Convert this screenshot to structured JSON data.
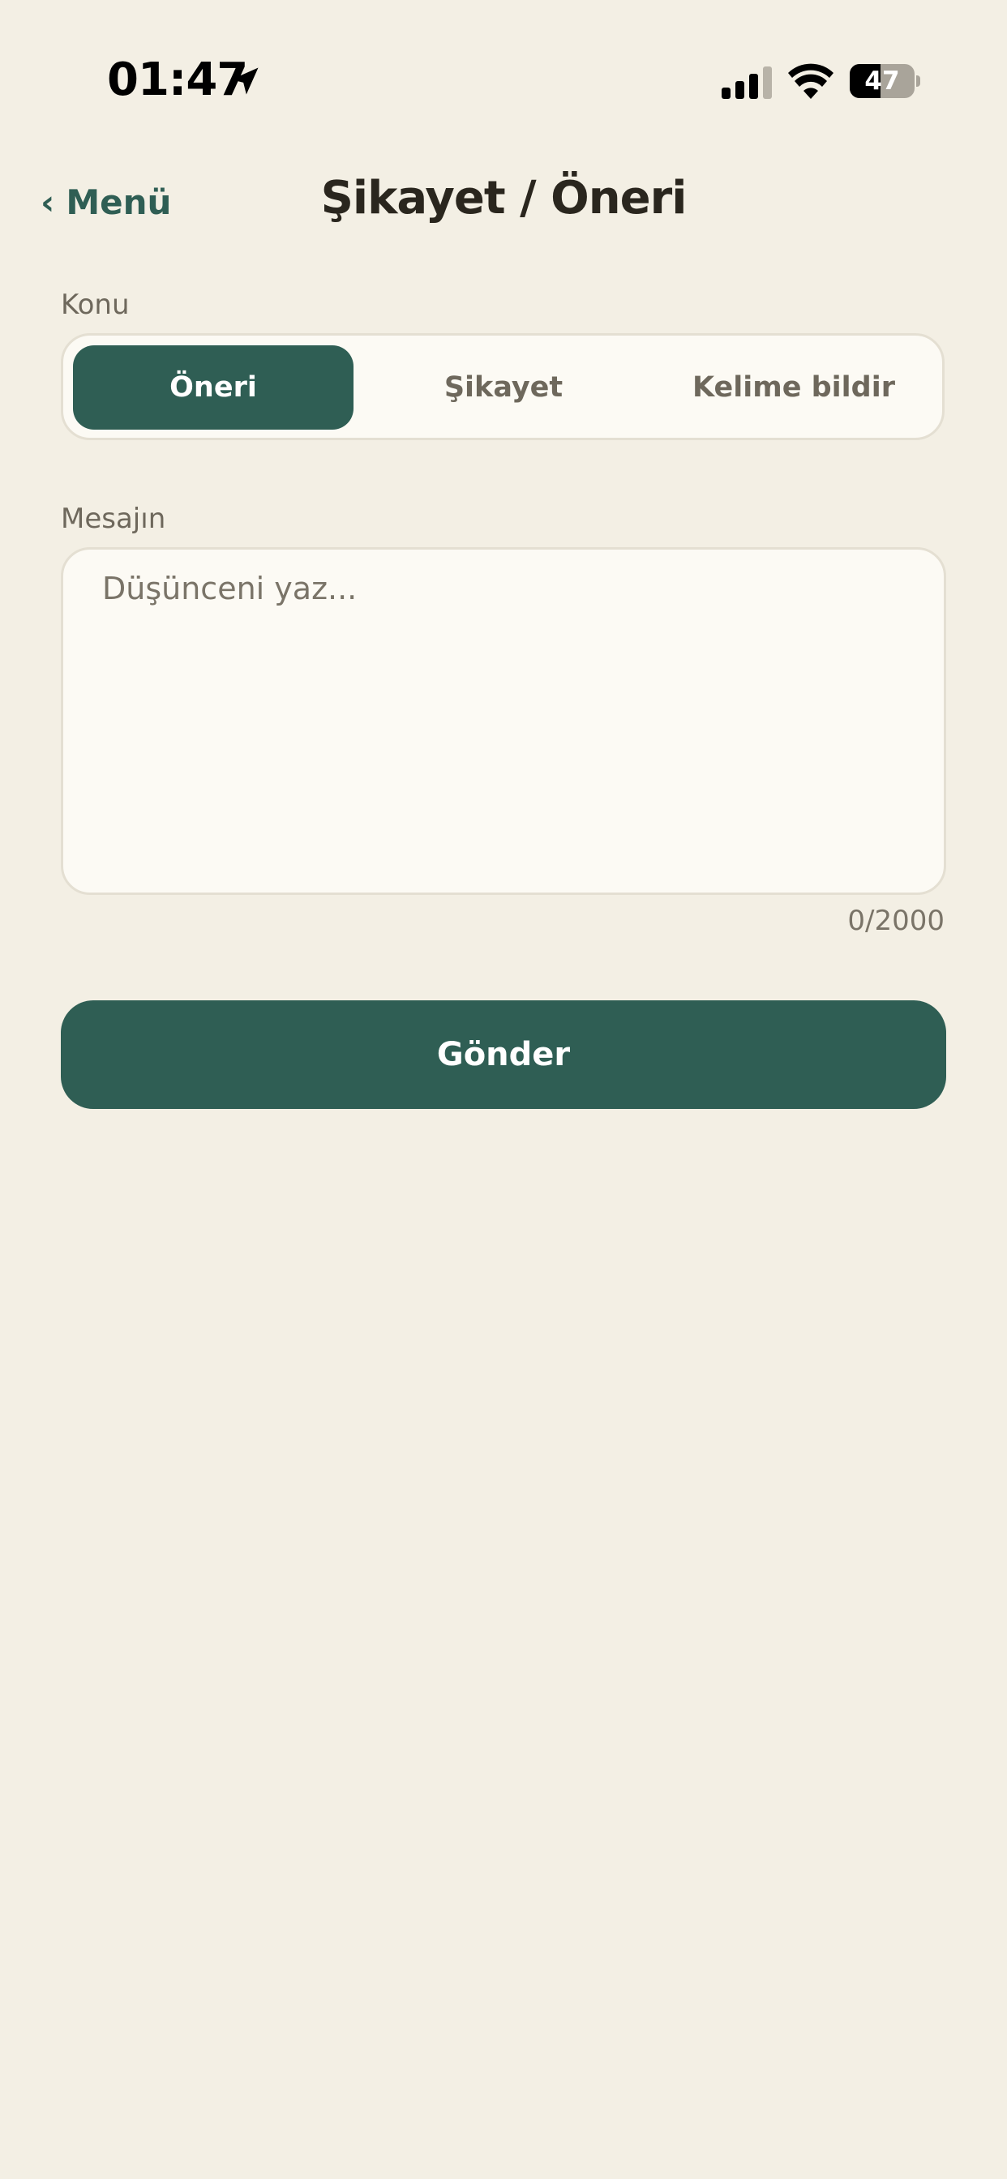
{
  "status_bar": {
    "time": "01:47",
    "battery": "47",
    "battery_level": 0.47
  },
  "nav": {
    "back_chevron": "‹",
    "back_label": "Menü",
    "title": "Şikayet / Öneri"
  },
  "form": {
    "topic_label": "Konu",
    "topics": [
      {
        "label": "Öneri",
        "selected": true
      },
      {
        "label": "Şikayet",
        "selected": false
      },
      {
        "label": "Kelime bildir",
        "selected": false
      }
    ],
    "message_label": "Mesajın",
    "message_value": "",
    "message_placeholder": "Düşünceni yaz...",
    "char_count": "0/2000",
    "submit_label": "Gönder"
  },
  "colors": {
    "background": "#F3EFE4",
    "accent": "#2F5E54",
    "card": "#FCFAF4",
    "border": "#E4DFD2"
  }
}
